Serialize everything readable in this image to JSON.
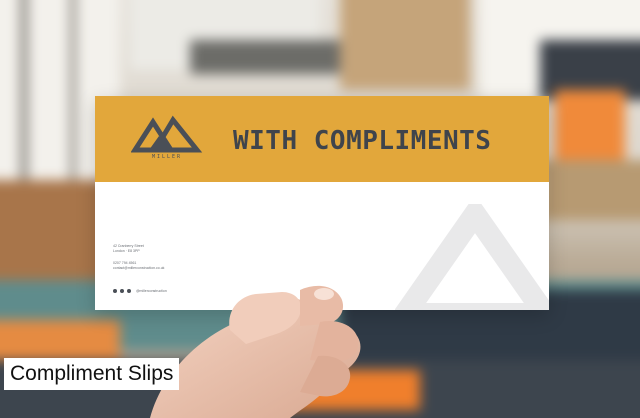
{
  "slip": {
    "logo_wordmark": "MILLER",
    "headline": "WITH COMPLIMENTS",
    "address_line_1": "42 Cranberry Street",
    "address_line_2": "London · E8 3PP",
    "phone": "0207 794 4561",
    "email": "contact@millerconstruction.co.uk",
    "social_handle": "@millerconstruction"
  },
  "caption": {
    "label": "Compliment Slips"
  },
  "colors": {
    "slip_header": "#e2a73b",
    "slip_text": "#3f444c",
    "caption_bg": "#ffffff"
  },
  "icons": [
    "mountain-logo-icon",
    "facebook-icon",
    "twitter-icon",
    "instagram-icon"
  ]
}
